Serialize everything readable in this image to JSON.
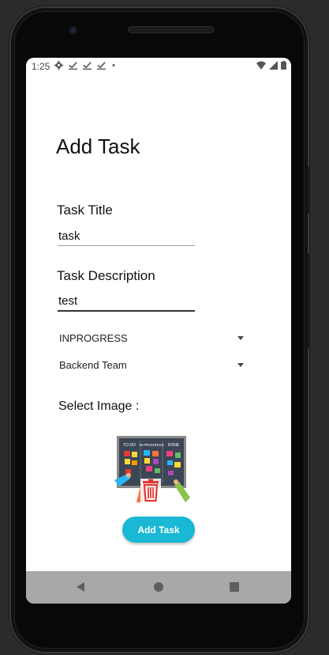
{
  "status_bar": {
    "time": "1:25",
    "left_icons": [
      "gear-icon",
      "check-notification-icon",
      "check-notification-icon",
      "check-notification-icon",
      "dot-icon"
    ],
    "right_icons": [
      "wifi-icon",
      "signal-icon",
      "battery-icon"
    ]
  },
  "form": {
    "heading": "Add Task",
    "task_title": {
      "label": "Task Title",
      "value": "task"
    },
    "task_description": {
      "label": "Task Description",
      "value": "test"
    },
    "status_select": {
      "selected": "INPROGRESS"
    },
    "team_select": {
      "selected": "Backend Team"
    },
    "select_image_label": "Select Image :",
    "image": {
      "board_headings": [
        "TO DO",
        "IN PROGRESS",
        "DONE"
      ],
      "overlay_icon": "trash-icon"
    },
    "submit_label": "Add Task"
  },
  "navigation": {
    "buttons": [
      "back-icon",
      "home-icon",
      "recents-icon"
    ]
  },
  "colors": {
    "accent": "#1ab8d4",
    "active_underline": "#333333",
    "inactive_underline": "#9e9e9e",
    "trash": "#e53935"
  }
}
